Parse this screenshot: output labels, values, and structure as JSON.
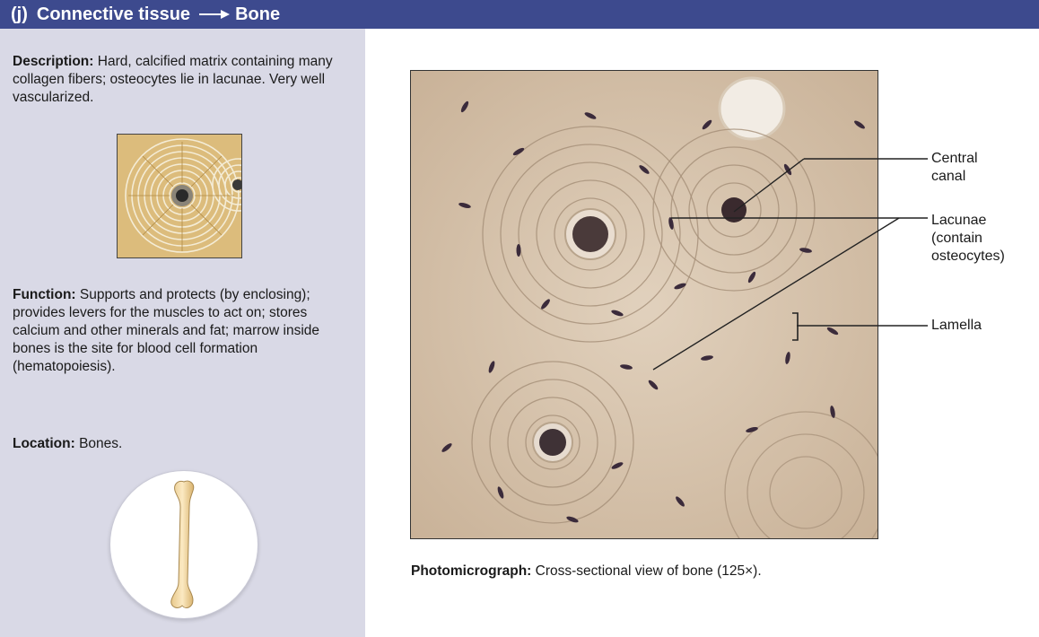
{
  "header": {
    "label": "(j)",
    "tissue": "Connective tissue",
    "subtype": "Bone",
    "bg_color": "#3d4a8e"
  },
  "description": {
    "heading": "Description:",
    "text": "Hard, calcified matrix containing many collagen fibers; osteocytes lie in lacunae. Very well vascularized."
  },
  "function": {
    "heading": "Function:",
    "text": "Supports and protects (by enclosing); provides levers for the muscles to act on; stores calcium and other minerals and fat; marrow inside bones is the site for blood cell formation (hematopoiesis)."
  },
  "location": {
    "heading": "Location:",
    "text": "Bones."
  },
  "icons": {
    "thumbnail": "osteon-illustration-icon",
    "location": "long-bone-icon"
  },
  "micrograph": {
    "labels": {
      "central_canal": "Central canal",
      "lacunae": "Lacunae (contain osteocytes)",
      "lamella": "Lamella"
    },
    "caption_heading": "Photomicrograph:",
    "caption_text": "Cross-sectional view of bone (125×)."
  }
}
